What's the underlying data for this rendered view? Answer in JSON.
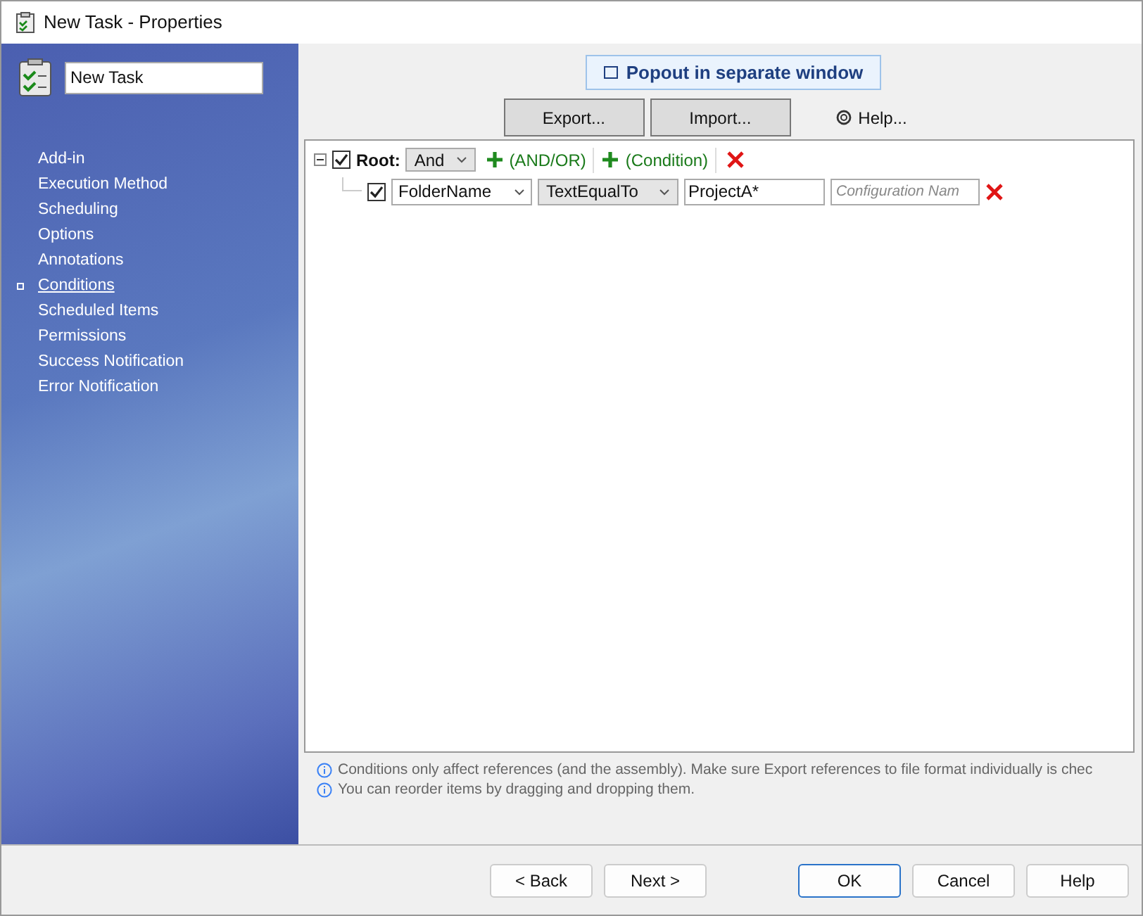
{
  "window": {
    "title": "New Task - Properties"
  },
  "sidebar": {
    "name_field": {
      "value": "New Task"
    },
    "items": [
      {
        "label": "Add-in",
        "selected": false
      },
      {
        "label": "Execution Method",
        "selected": false
      },
      {
        "label": "Scheduling",
        "selected": false
      },
      {
        "label": "Options",
        "selected": false
      },
      {
        "label": "Annotations",
        "selected": false
      },
      {
        "label": "Conditions",
        "selected": true
      },
      {
        "label": "Scheduled Items",
        "selected": false
      },
      {
        "label": "Permissions",
        "selected": false
      },
      {
        "label": "Success Notification",
        "selected": false
      },
      {
        "label": "Error Notification",
        "selected": false
      }
    ]
  },
  "popout_button": "Popout in separate window",
  "toolbar": {
    "export": "Export...",
    "import": "Import...",
    "help": "Help..."
  },
  "tree": {
    "root": {
      "expanded": true,
      "checked": true,
      "label": "Root:",
      "operator": "And",
      "add_group": "(AND/OR)",
      "add_condition": "(Condition)"
    },
    "conditions": [
      {
        "checked": true,
        "field": "FolderName",
        "operator": "TextEqualTo",
        "value": "ProjectA*",
        "placeholder": "Configuration Nam"
      }
    ]
  },
  "notes": [
    "Conditions only affect references (and the assembly). Make sure Export references to file format individually is chec",
    "You can reorder items by dragging and dropping them."
  ],
  "buttons": {
    "back": "< Back",
    "next": "Next >",
    "ok": "OK",
    "cancel": "Cancel",
    "help": "Help"
  }
}
